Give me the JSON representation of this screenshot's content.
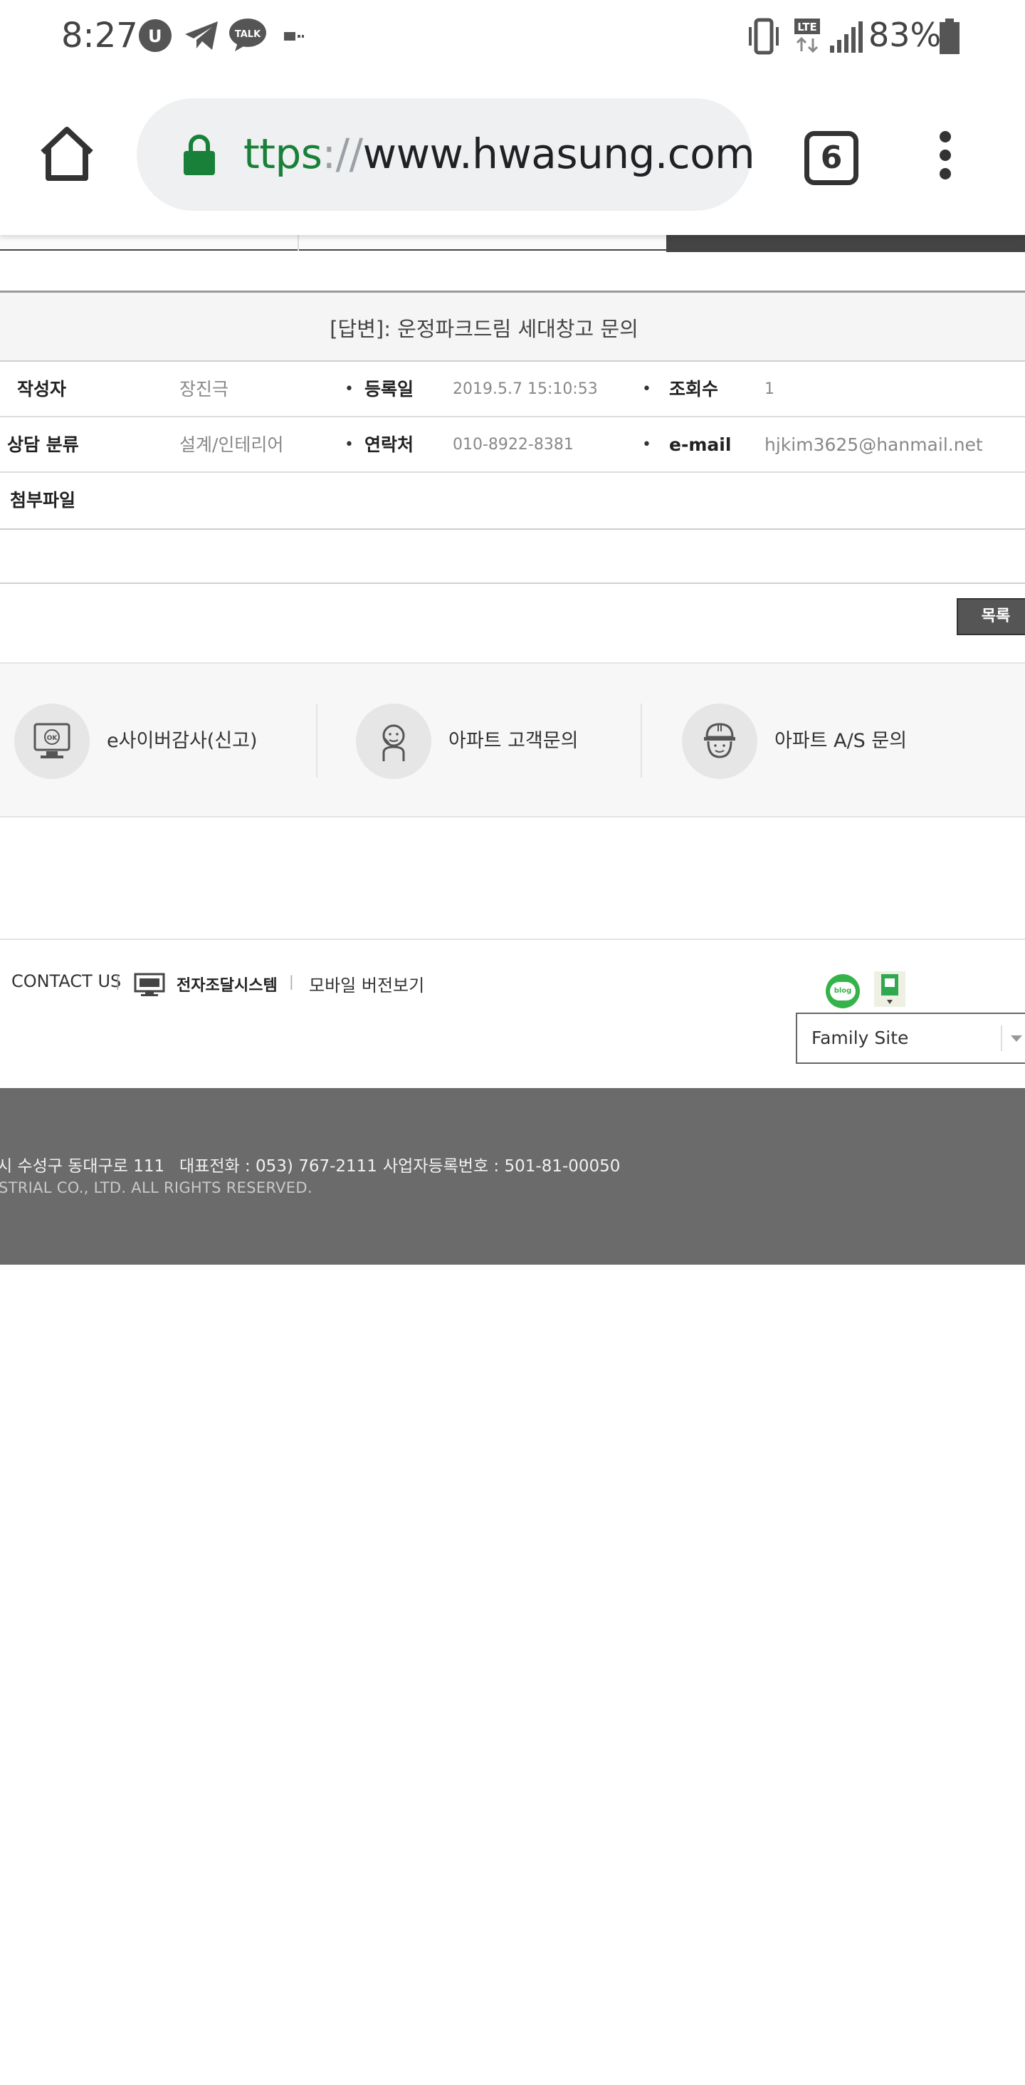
{
  "status_bar": {
    "time": "8:27",
    "battery_percent": "83%",
    "network_label": "LTE",
    "talk_badge": "TALK"
  },
  "browser": {
    "url_scheme": "ttps",
    "url_separator": "://",
    "url_host": "www.hwasung.com",
    "tab_count": "6",
    "secure_color": "#188038"
  },
  "post": {
    "title": "[답변]: 운정파크드림 세대창고 문의",
    "fields": {
      "author_label": "작성자",
      "author_value": "장진극",
      "date_label": "등록일",
      "date_value": "2019.5.7 15:10:53",
      "views_label": "조회수",
      "views_value": "1",
      "category_label": "상담 분류",
      "category_value": "설계/인테리어",
      "phone_label": "연락처",
      "phone_value": "010-8922-8381",
      "email_label": "e-mail",
      "email_value": "hjkim3625@hanmail.net",
      "attachment_label": "첨부파일"
    },
    "list_button": "목록"
  },
  "quick_links": [
    {
      "label": "e사이버감사(신고)",
      "icon": "monitor-ok-icon"
    },
    {
      "label": "아파트 고객문의",
      "icon": "operator-headset-icon"
    },
    {
      "label": "아파트 A/S 문의",
      "icon": "worker-helmet-icon"
    }
  ],
  "footer": {
    "contact_us": "CONTACT US",
    "separator": "|",
    "edi_label": "전자조달시스템",
    "mobile_version": "모바일 버전보기",
    "blog_badge": "blog",
    "family_site": "Family Site",
    "address": "시 수성구 동대구로 111",
    "phone": "대표전화 : 053) 767-2111",
    "business_number": "사업자등록번호 : 501-81-00050",
    "copyright": "STRIAL CO., LTD. ALL RIGHTS RESERVED.",
    "bg_color": "#6b6b6b"
  }
}
